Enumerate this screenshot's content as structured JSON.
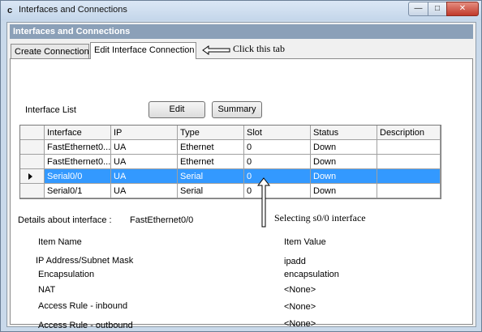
{
  "window": {
    "app_icon": "c",
    "title": "Interfaces and Connections",
    "controls": {
      "minimize": "—",
      "maximize": "□",
      "close": "✕"
    }
  },
  "header": {
    "title": "Interfaces and Connections"
  },
  "tabs": [
    {
      "label": "Create Connection",
      "active": false
    },
    {
      "label": "Edit Interface Connection",
      "active": true
    }
  ],
  "annotations": {
    "tab_hint": "Click this tab",
    "selection_hint": "Selecting s0/0 interface"
  },
  "interface_list": {
    "label": "Interface List",
    "edit_button": "Edit",
    "summary_button": "Summary",
    "columns": [
      "Interface",
      "IP",
      "Type",
      "Slot",
      "Status",
      "Description"
    ],
    "rows": [
      [
        "FastEthernet0...",
        "UA",
        "Ethernet",
        "0",
        "Down",
        ""
      ],
      [
        "FastEthernet0...",
        "UA",
        "Ethernet",
        "0",
        "Down",
        ""
      ],
      [
        "Serial0/0",
        "UA",
        "Serial",
        "0",
        "Down",
        ""
      ],
      [
        "Serial0/1",
        "UA",
        "Serial",
        "0",
        "Down",
        ""
      ]
    ],
    "selected_row": 2
  },
  "details": {
    "label": "Details about interface :",
    "interface": "FastEthernet0/0",
    "name_header": "Item Name",
    "value_header": "Item Value",
    "items": [
      {
        "name": "IP Address/Subnet Mask",
        "value": "ipadd"
      },
      {
        "name": "Encapsulation",
        "value": "encapsulation"
      },
      {
        "name": "NAT",
        "value": "<None>"
      },
      {
        "name": "Access Rule - inbound",
        "value": "<None>"
      },
      {
        "name": "Access Rule - outbound",
        "value": "<None>"
      }
    ]
  }
}
